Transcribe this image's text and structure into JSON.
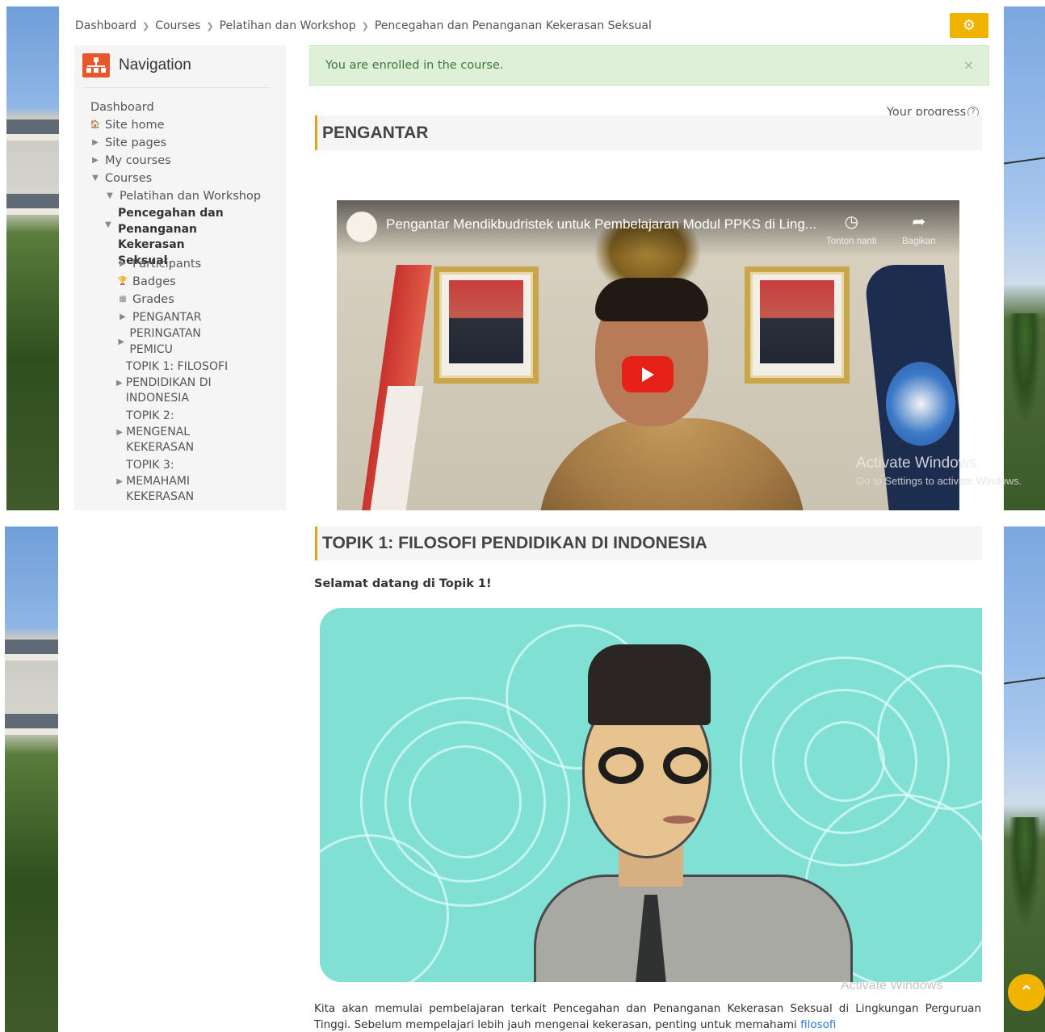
{
  "breadcrumb": {
    "items": [
      "Dashboard",
      "Courses",
      "Pelatihan dan Workshop",
      "Pencegahan dan Penanganan Kekerasan Seksual"
    ]
  },
  "settings_button": {
    "icon": "gear-icon"
  },
  "navigation": {
    "title": "Navigation",
    "icon": "sitemap-icon",
    "items": {
      "dashboard": "Dashboard",
      "site_home": "Site home",
      "site_pages": "Site pages",
      "my_courses": "My courses",
      "courses": "Courses",
      "pelatihan": "Pelatihan dan Workshop",
      "current_course": "Pencegahan dan Penanganan Kekerasan Seksual",
      "participants": "Participants",
      "badges": "Badges",
      "grades": "Grades",
      "pengantar": "PENGANTAR",
      "peringatan": "PERINGATAN PEMICU",
      "topik1": "TOPIK 1: FILOSOFI PENDIDIKAN DI INDONESIA",
      "topik2": "TOPIK 2: MENGENAL KEKERASAN",
      "topik3": "TOPIK 3: MEMAHAMI KEKERASAN"
    }
  },
  "alert": {
    "message": "You are enrolled in the course.",
    "close": "×"
  },
  "progress": {
    "label": "Your progress",
    "help": "?"
  },
  "sections": {
    "pengantar": "PENGANTAR",
    "topik1": "TOPIK 1: FILOSOFI PENDIDIKAN DI INDONESIA"
  },
  "video": {
    "title": "Pengantar Mendikbudristek untuk Pembelajaran Modul PPKS di Ling...",
    "watch_later": "Tonton nanti",
    "share": "Bagikan"
  },
  "watermark": {
    "line1": "Activate Windows",
    "line2": "Go to Settings to activate Windows."
  },
  "topik1": {
    "welcome": "Selamat datang di Topik 1!",
    "paragraph": "Kita akan memulai pembelajaran terkait Pencegahan dan Penanganan Kekerasan Seksual di Lingkungan Perguruan Tinggi. Sebelum mempelajari lebih jauh mengenai kekerasan, penting untuk memahami",
    "link": "filosofi"
  },
  "colors": {
    "accent": "#f0b400",
    "nav_logo": "#e8572c",
    "alert_bg": "#dff0d8",
    "section_border": "#e3a21c",
    "illustration_bg": "#7fe0d3",
    "link": "#2a7ad6"
  }
}
